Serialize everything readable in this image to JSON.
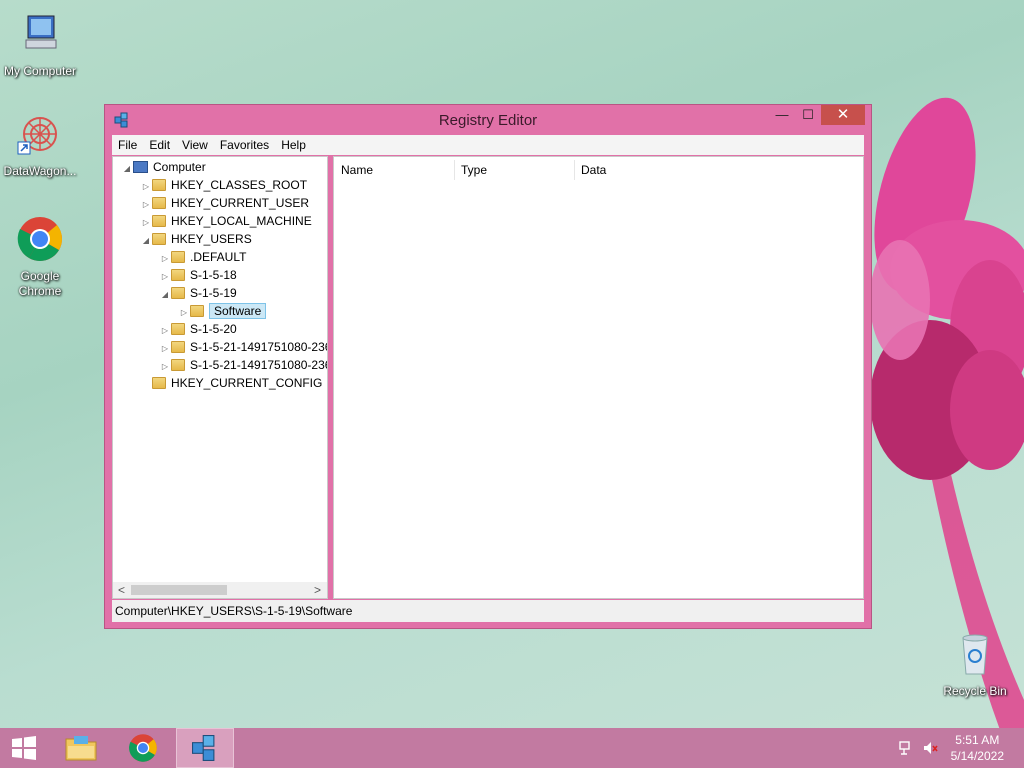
{
  "desktop": {
    "icons": [
      {
        "label": "My Computer"
      },
      {
        "label": "DataWagon..."
      },
      {
        "label": "Google Chrome"
      },
      {
        "label": "Recycle Bin"
      }
    ]
  },
  "window": {
    "title": "Registry Editor",
    "controls": {
      "minimize": "—",
      "maximize": "☐",
      "close": "✕"
    },
    "menu": [
      "File",
      "Edit",
      "View",
      "Favorites",
      "Help"
    ],
    "tree": [
      {
        "label": "Computer",
        "expander": "◢"
      },
      {
        "label": "HKEY_CLASSES_ROOT",
        "expander": "▷"
      },
      {
        "label": "HKEY_CURRENT_USER",
        "expander": "▷"
      },
      {
        "label": "HKEY_LOCAL_MACHINE",
        "expander": "▷"
      },
      {
        "label": "HKEY_USERS",
        "expander": "◢"
      },
      {
        "label": ".DEFAULT",
        "expander": "▷"
      },
      {
        "label": "S-1-5-18",
        "expander": "▷"
      },
      {
        "label": "S-1-5-19",
        "expander": "◢"
      },
      {
        "label": "Software",
        "expander": "▷"
      },
      {
        "label": "S-1-5-20",
        "expander": "▷"
      },
      {
        "label": "S-1-5-21-1491751080-236",
        "expander": "▷"
      },
      {
        "label": "S-1-5-21-1491751080-236",
        "expander": "▷"
      },
      {
        "label": "HKEY_CURRENT_CONFIG",
        "expander": ""
      }
    ],
    "scroll_arrows": {
      "left": "<",
      "right": ">"
    },
    "columns": [
      "Name",
      "Type",
      "Data"
    ],
    "status": "Computer\\HKEY_USERS\\S-1-5-19\\Software"
  },
  "taskbar": {
    "time": "5:51 AM",
    "date": "5/14/2022",
    "items": [
      "start-button",
      "file-explorer",
      "google-chrome",
      "registry-editor"
    ]
  },
  "colors": {
    "window_frame": "#e171a8",
    "close_button": "#c7504c",
    "taskbar": "#c27aa1",
    "selection": "#cce8f6"
  }
}
